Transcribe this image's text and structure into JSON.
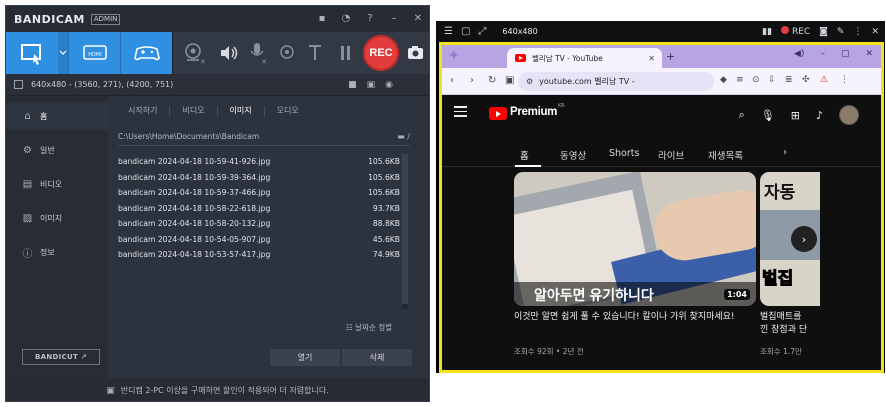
{
  "bandicam": {
    "title": "BANDICAM",
    "badge": "ADMIN",
    "rec_label": "REC",
    "hdmi_label": "HDMI",
    "capture_info": "640x480 - (3560, 271), (4200, 751)",
    "sidebar": [
      {
        "label": "홈",
        "icon": "home-icon"
      },
      {
        "label": "일반",
        "icon": "gear-icon"
      },
      {
        "label": "비디오",
        "icon": "video-icon"
      },
      {
        "label": "이미지",
        "icon": "image-icon"
      },
      {
        "label": "정보",
        "icon": "info-icon"
      }
    ],
    "bandicut_label": "BANDICUT ↗",
    "tabs": [
      "시작하기",
      "비디오",
      "이미지",
      "오디오"
    ],
    "active_tab": "이미지",
    "folder_path": "C:\\Users\\Home\\Documents\\Bandicam",
    "files": [
      {
        "name": "bandicam 2024-04-18 10-59-41-926.jpg",
        "size": "105.6KB"
      },
      {
        "name": "bandicam 2024-04-18 10-59-39-364.jpg",
        "size": "105.6KB"
      },
      {
        "name": "bandicam 2024-04-18 10-59-37-466.jpg",
        "size": "105.6KB"
      },
      {
        "name": "bandicam 2024-04-18 10-58-22-618.jpg",
        "size": "93.7KB"
      },
      {
        "name": "bandicam 2024-04-18 10-58-20-132.jpg",
        "size": "88.8KB"
      },
      {
        "name": "bandicam 2024-04-18 10-54-05-907.jpg",
        "size": "45.6KB"
      },
      {
        "name": "bandicam 2024-04-18 10-53-57-417.jpg",
        "size": "74.9KB"
      }
    ],
    "sort_label": "날짜순 정렬",
    "open_label": "열기",
    "delete_label": "삭제",
    "footer": "반디캠 2-PC 이상을 구매하면 할인이 적용되어 더 저렴합니다."
  },
  "capture": {
    "size_label": "640x480",
    "rec_label": "REC"
  },
  "browser": {
    "tab_title": "벨리남 TV - YouTube",
    "address": "youtube.com 벨리남 TV -",
    "colors": {
      "frame": "#b6a4e3",
      "highlight": "#f2e21a"
    }
  },
  "youtube": {
    "brand": "Premium",
    "region": "KR",
    "chips": [
      "홈",
      "동영상",
      "Shorts",
      "라이브",
      "재생목록"
    ],
    "active_chip": "홈",
    "videos": [
      {
        "thumb_caption": "알아두면 유기하니다",
        "duration": "1:04",
        "title": "이것만 알면 쉽게 풀 수 있습니다! 칼이나 가위 찾지마세요!",
        "meta": "조회수 92회 • 2년 전"
      },
      {
        "thumb_top": "자동",
        "thumb_bottom": "벌집",
        "title": "벌집매트를\n낀 장점과 단",
        "meta": "조회수 1.7만"
      }
    ]
  }
}
